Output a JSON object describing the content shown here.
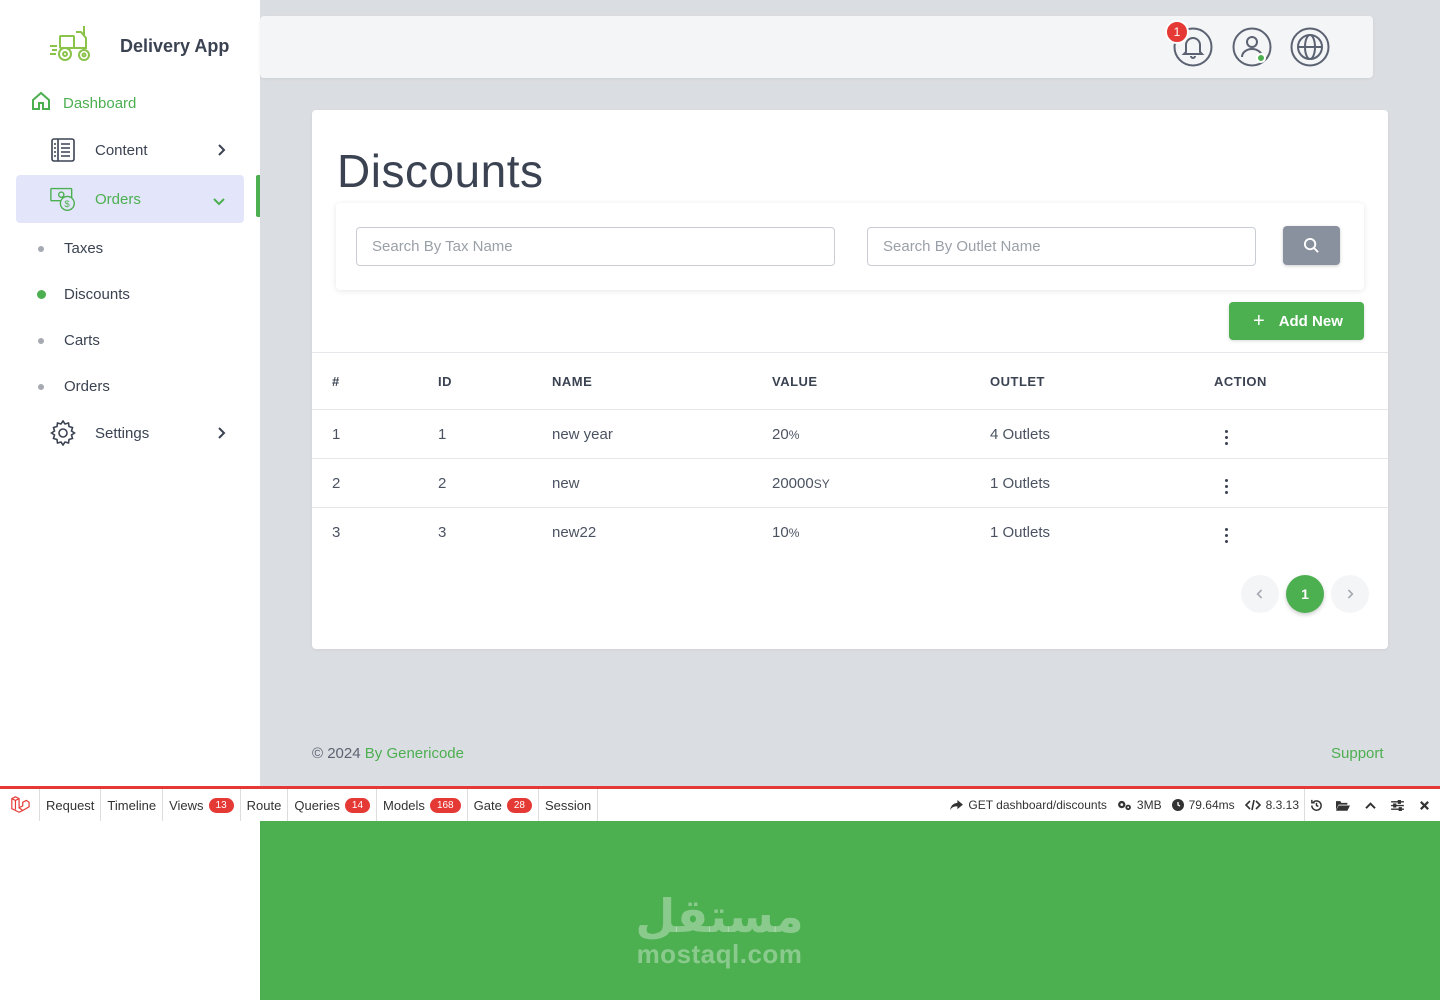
{
  "app": {
    "name": "Delivery App"
  },
  "sidebar": {
    "dashboard": "Dashboard",
    "items": [
      {
        "label": "Content"
      },
      {
        "label": "Orders"
      },
      {
        "label": "Settings"
      }
    ],
    "orders_sub": [
      {
        "label": "Taxes"
      },
      {
        "label": "Discounts"
      },
      {
        "label": "Carts"
      },
      {
        "label": "Orders"
      }
    ]
  },
  "header": {
    "notification_count": "1"
  },
  "page": {
    "title": "Discounts",
    "search_tax_placeholder": "Search By Tax Name",
    "search_outlet_placeholder": "Search By Outlet Name",
    "add_new": "Add New"
  },
  "table": {
    "headers": [
      "#",
      "ID",
      "NAME",
      "VALUE",
      "OUTLET",
      "ACTION"
    ],
    "rows": [
      {
        "index": "1",
        "id": "1",
        "name": "new year",
        "value": "20",
        "unit": "%",
        "outlet": "4 Outlets"
      },
      {
        "index": "2",
        "id": "2",
        "name": "new",
        "value": "20000",
        "unit": "SY",
        "outlet": "1 Outlets"
      },
      {
        "index": "3",
        "id": "3",
        "name": "new22",
        "value": "10",
        "unit": "%",
        "outlet": "1 Outlets"
      }
    ]
  },
  "pagination": {
    "current": "1"
  },
  "footer": {
    "copyright": "© 2024 ",
    "author": "By Genericode",
    "support": "Support"
  },
  "debugbar": {
    "tabs": [
      {
        "label": "Request"
      },
      {
        "label": "Timeline"
      },
      {
        "label": "Views",
        "count": "13"
      },
      {
        "label": "Route"
      },
      {
        "label": "Queries",
        "count": "14"
      },
      {
        "label": "Models",
        "count": "168"
      },
      {
        "label": "Gate",
        "count": "28"
      },
      {
        "label": "Session"
      }
    ],
    "route": "GET dashboard/discounts",
    "memory": "3MB",
    "time": "79.64ms",
    "php_version": "8.3.13"
  },
  "watermark": {
    "arabic": "مستقل",
    "latin": "mostaql.com"
  },
  "colors": {
    "accent": "#4caf50",
    "badge": "#e53935",
    "active_bg": "#e3e6fb"
  }
}
